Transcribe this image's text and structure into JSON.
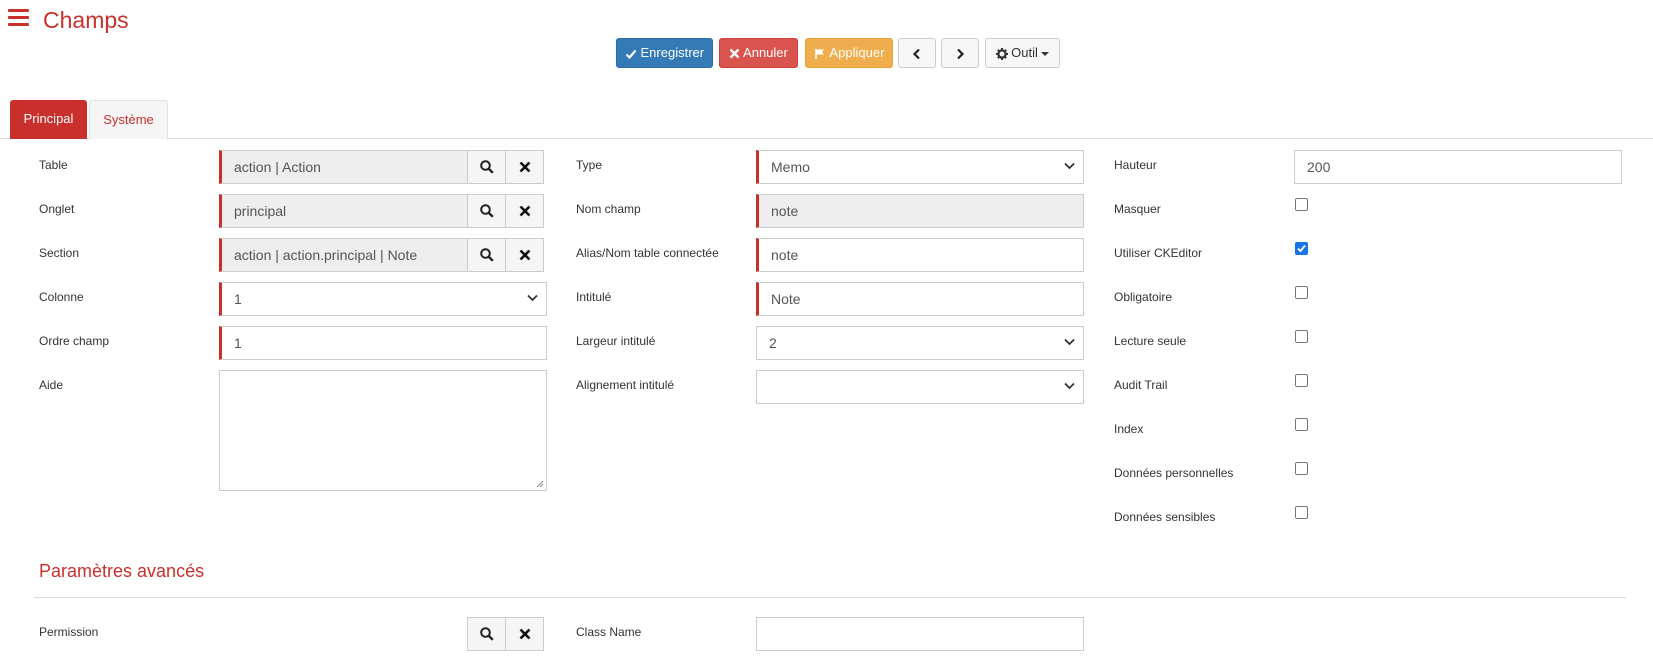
{
  "header": {
    "title": "Champs"
  },
  "toolbar": {
    "save": "Enregistrer",
    "cancel": "Annuler",
    "apply": "Appliquer",
    "tool": "Outil"
  },
  "tabs": [
    {
      "label": "Principal",
      "active": true
    },
    {
      "label": "Système",
      "active": false
    }
  ],
  "col1": {
    "table_label": "Table",
    "table_value": "action | Action",
    "onglet_label": "Onglet",
    "onglet_value": "principal",
    "section_label": "Section",
    "section_value": "action | action.principal | Note",
    "colonne_label": "Colonne",
    "colonne_value": "1",
    "ordre_label": "Ordre champ",
    "ordre_value": "1",
    "aide_label": "Aide",
    "aide_value": ""
  },
  "col2": {
    "type_label": "Type",
    "type_value": "Memo",
    "nom_label": "Nom champ",
    "nom_value": "note",
    "alias_label": "Alias/Nom table connectée",
    "alias_value": "note",
    "intitule_label": "Intitulé",
    "intitule_value": "Note",
    "largeur_label": "Largeur intitulé",
    "largeur_value": "2",
    "alignement_label": "Alignement intitulé",
    "alignement_value": ""
  },
  "col3": {
    "hauteur_label": "Hauteur",
    "hauteur_value": "200",
    "checkboxes": [
      {
        "label": "Masquer",
        "checked": false
      },
      {
        "label": "Utiliser CKEditor",
        "checked": true
      },
      {
        "label": "Obligatoire",
        "checked": false
      },
      {
        "label": "Lecture seule",
        "checked": false
      },
      {
        "label": "Audit Trail",
        "checked": false
      },
      {
        "label": "Index",
        "checked": false
      },
      {
        "label": "Données personnelles",
        "checked": false
      },
      {
        "label": "Données sensibles",
        "checked": false
      }
    ]
  },
  "advanced": {
    "title": "Paramètres avancés",
    "permission_label": "Permission",
    "permission_value": "",
    "classname_label": "Class Name",
    "classname_value": ""
  },
  "colors": {
    "accent": "#c9302c",
    "primary": "#337ab7",
    "danger": "#d9534f",
    "warning": "#f0ad4e",
    "check": "#1a73e8"
  }
}
